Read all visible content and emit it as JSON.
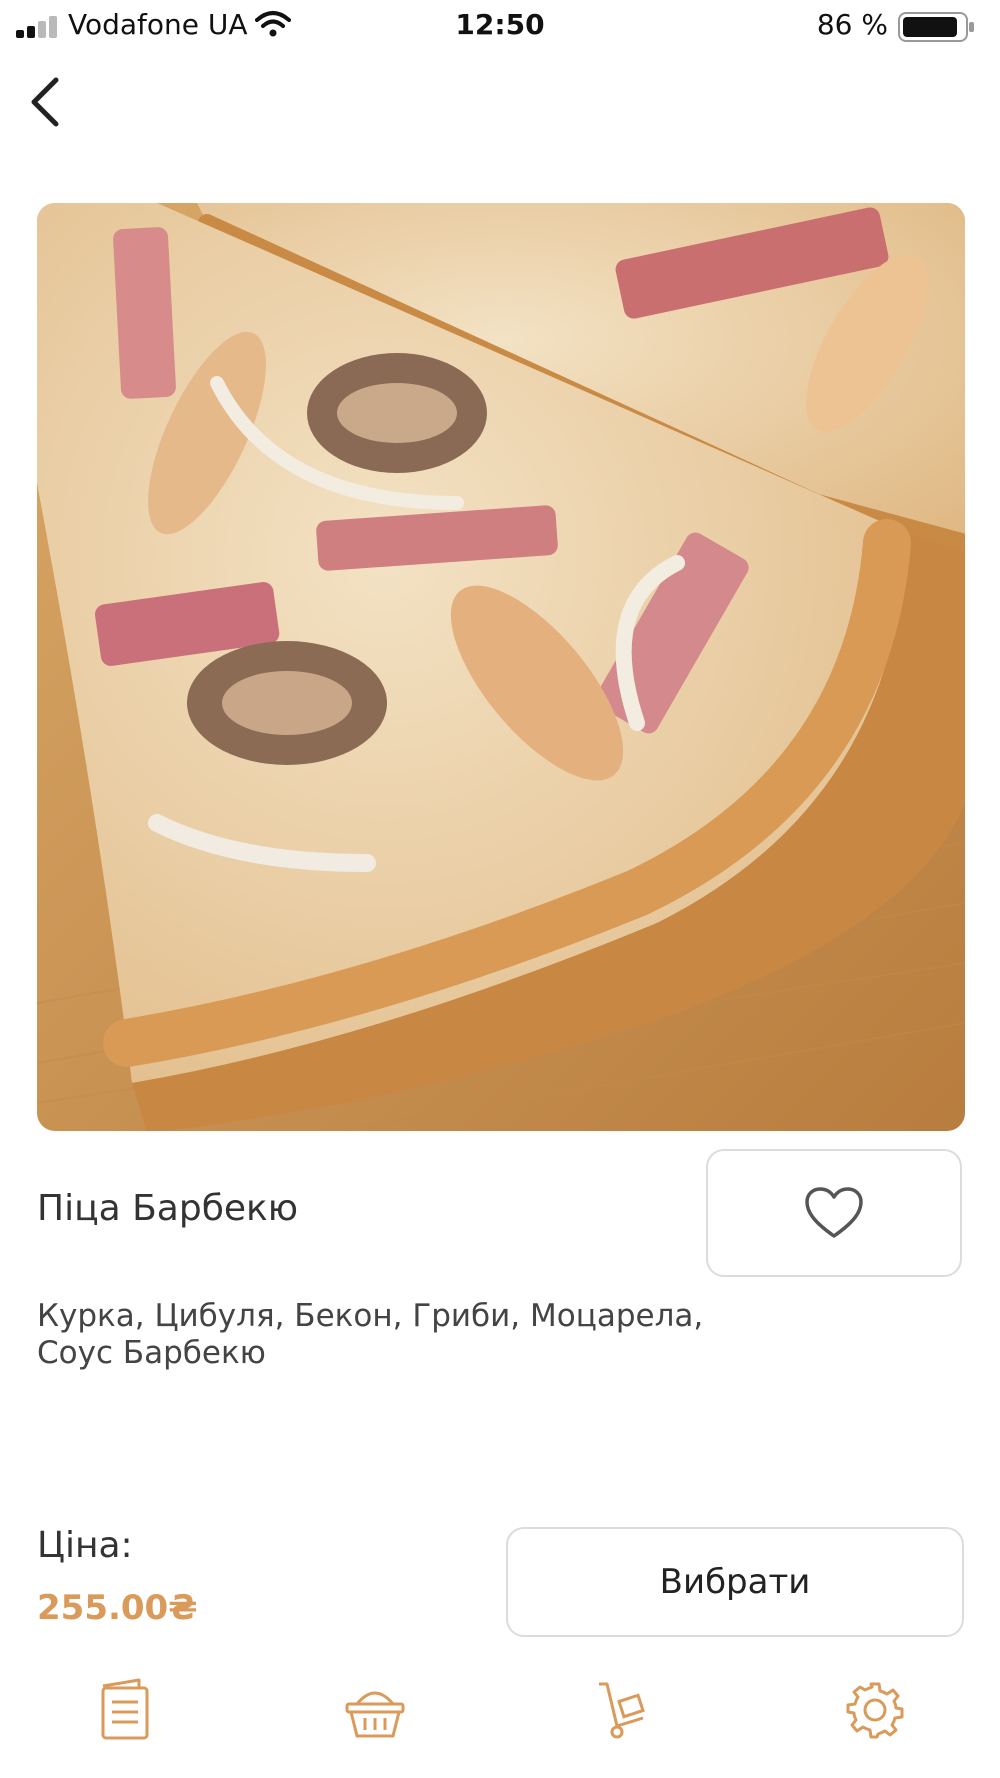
{
  "status_bar": {
    "carrier": "Vodafone UA",
    "time": "12:50",
    "battery": "86 %"
  },
  "product": {
    "title": "Піца Барбекю",
    "ingredients": "Курка, Цибуля, Бекон, Гриби, Моцарела, Соус Барбекю"
  },
  "price": {
    "label": "Ціна:",
    "value": "255.00₴"
  },
  "actions": {
    "select_label": "Вибрати"
  },
  "tab_bar": {
    "items": [
      {
        "icon": "menu-list-icon"
      },
      {
        "icon": "basket-icon"
      },
      {
        "icon": "delivery-cart-icon"
      },
      {
        "icon": "settings-gear-icon"
      }
    ]
  },
  "colors": {
    "accent": "#d99a5a",
    "border": "#dcdcdc",
    "text": "#333333"
  }
}
